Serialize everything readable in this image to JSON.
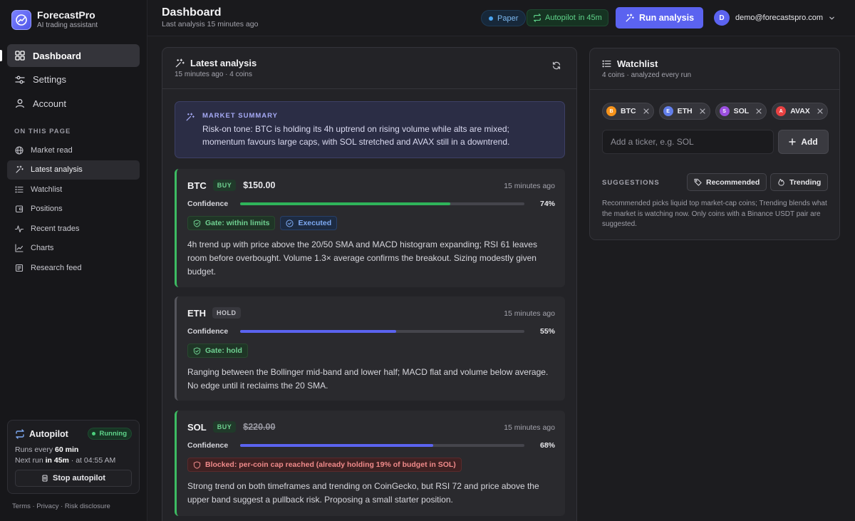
{
  "brand": {
    "name": "ForecastPro",
    "subtitle": "AI trading assistant"
  },
  "nav": [
    {
      "label": "Dashboard",
      "icon": "grid-icon",
      "active": true
    },
    {
      "label": "Settings",
      "icon": "sliders-icon"
    },
    {
      "label": "Account",
      "icon": "user-icon"
    }
  ],
  "on_this_page": {
    "label": "ON THIS PAGE",
    "items": [
      {
        "label": "Market read",
        "icon": "globe-icon"
      },
      {
        "label": "Latest analysis",
        "icon": "sparkle-icon",
        "active": true
      },
      {
        "label": "Watchlist",
        "icon": "list-icon"
      },
      {
        "label": "Positions",
        "icon": "wallet-icon"
      },
      {
        "label": "Recent trades",
        "icon": "pulse-icon"
      },
      {
        "label": "Charts",
        "icon": "chart-icon"
      },
      {
        "label": "Research feed",
        "icon": "newspaper-icon"
      }
    ]
  },
  "autopilot": {
    "title": "Autopilot",
    "status": "Running",
    "runs_prefix": "Runs every",
    "runs_value": "60 min",
    "next_prefix": "Next run",
    "next_value": "in 45m",
    "next_suffix": "· at 04:55 AM",
    "stop_label": "Stop autopilot"
  },
  "footer": "Terms · Privacy · Risk disclosure",
  "header": {
    "title": "Dashboard",
    "subtitle": "Last analysis 15 minutes ago",
    "paper_label": "Paper",
    "autopilot_label": "Autopilot",
    "autopilot_in": "in 45m",
    "run_label": "Run analysis",
    "user_initial": "D",
    "user_email": "demo@forecastspro.com"
  },
  "analysis": {
    "title": "Latest analysis",
    "subtitle": "15 minutes ago · 4 coins",
    "summary_label": "MARKET SUMMARY",
    "summary_text": "Risk-on tone: BTC is holding its 4h uptrend on rising volume while alts are mixed; momentum favours large caps, with SOL stretched and AVAX still in a downtrend.",
    "confidence_label": "Confidence",
    "coins": [
      {
        "symbol": "BTC",
        "action": "BUY",
        "price": "$150.00",
        "time": "15 minutes ago",
        "confidence": 0.74,
        "confidence_label": "74%",
        "tags": [
          {
            "label": "Gate: within limits",
            "kind": "green"
          },
          {
            "label": "Executed",
            "kind": "blue"
          }
        ],
        "desc": "4h trend up with price above the 20/50 SMA and MACD histogram expanding; RSI 61 leaves room before overbought. Volume 1.3× average confirms the breakout. Sizing modestly given budget."
      },
      {
        "symbol": "ETH",
        "action": "HOLD",
        "price": "",
        "time": "15 minutes ago",
        "confidence": 0.55,
        "confidence_label": "55%",
        "tags": [
          {
            "label": "Gate: hold",
            "kind": "green"
          }
        ],
        "desc": "Ranging between the Bollinger mid-band and lower half; MACD flat and volume below average. No edge until it reclaims the 20 SMA."
      },
      {
        "symbol": "SOL",
        "action": "BUY",
        "price": "$220.00",
        "time": "15 minutes ago",
        "confidence": 0.68,
        "confidence_label": "68%",
        "tags": [
          {
            "label": "Blocked: per-coin cap reached (already holding 19% of budget in SOL)",
            "kind": "red"
          }
        ],
        "desc": "Strong trend on both timeframes and trending on CoinGecko, but RSI 72 and price above the upper band suggest a pullback risk. Proposing a small starter position."
      }
    ]
  },
  "watchlist": {
    "title": "Watchlist",
    "subtitle": "4 coins · analyzed every run",
    "coins": [
      {
        "symbol": "BTC",
        "initial": "B",
        "color": "#f7931a"
      },
      {
        "symbol": "ETH",
        "initial": "E",
        "color": "#627eea"
      },
      {
        "symbol": "SOL",
        "initial": "S",
        "color": "#9b4fe0"
      },
      {
        "symbol": "AVAX",
        "initial": "A",
        "color": "#e84142"
      }
    ],
    "input_placeholder": "Add a ticker, e.g. SOL",
    "add_label": "Add",
    "suggestions_label": "SUGGESTIONS",
    "recommended_label": "Recommended",
    "trending_label": "Trending",
    "note": "Recommended picks liquid top market-cap coins; Trending blends what the market is watching now. Only coins with a Binance USDT pair are suggested."
  },
  "colors": {
    "accent": "#5b63f0",
    "buy": "#3dbb62",
    "bar_buy": "#2fb35a",
    "bar_other": "#5b63f0"
  }
}
